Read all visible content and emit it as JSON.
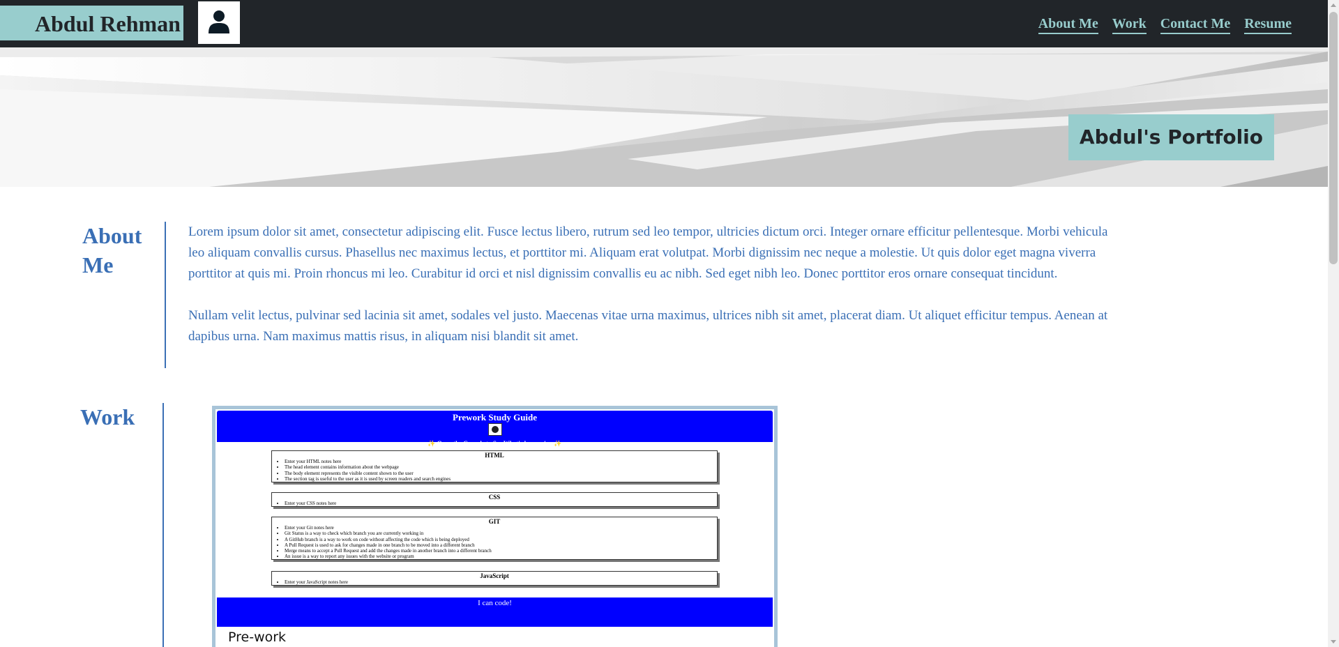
{
  "header": {
    "brand": "Abdul Rehman",
    "avatar_icon": "user-icon",
    "nav": [
      {
        "label": "About Me"
      },
      {
        "label": "Work"
      },
      {
        "label": "Contact Me"
      },
      {
        "label": "Resume"
      }
    ]
  },
  "hero": {
    "title": "Abdul's Portfolio"
  },
  "about": {
    "title_line1": "About",
    "title_line2": "Me",
    "paragraphs": [
      "Lorem ipsum dolor sit amet, consectetur adipiscing elit. Fusce lectus libero, rutrum sed leo tempor, ultricies dictum orci. Integer ornare efficitur pellentesque. Morbi vehicula leo aliquam convallis cursus. Phasellus nec maximus lectus, et porttitor mi. Aliquam erat volutpat. Morbi dignissim nec neque a molestie. Ut quis dolor eget magna viverra porttitor at quis mi. Proin rhoncus mi leo. Curabitur id orci et nisl dignissim convallis eu ac nibh. Sed eget nibh leo. Donec porttitor eros ornare consequat tincidunt.",
      "Nullam velit lectus, pulvinar sed lacinia sit amet, sodales vel justo. Maecenas vitae urna maximus, ultrices nibh sit amet, placerat diam. Ut aliquet efficitur tempus. Aenean at dapibus urna. Nam maximus mattis risus, in aliquam nisi blandit sit amet."
    ]
  },
  "work": {
    "title": "Work",
    "project": {
      "caption": "Pre-work",
      "screenshot": {
        "heading": "Prework Study Guide",
        "subheading": "✨ Open the Console to See What's happening ✨",
        "sections": [
          {
            "title": "HTML",
            "items": [
              "Enter your HTML notes here",
              "The head element contains information about the webpage",
              "The body element represents the visible content shown to the user",
              "The section tag is useful to the user as it is used by screen readers and search engines"
            ]
          },
          {
            "title": "CSS",
            "items": [
              "Enter your CSS notes here"
            ]
          },
          {
            "title": "GIT",
            "items": [
              "Enter your Git notes here",
              "Git Status is a way to check which branch you are currently working in",
              "A GitHub branch is a way to work on code without affecting the code which is being deployed",
              "A Pull Request is used to ask for changes made in one branch to be moved into a different branch",
              "Merge means to accept a Pull Request and add the changes made in another branch into a different branch",
              "An issue is a way to report any issues with the website or program"
            ]
          },
          {
            "title": "JavaScript",
            "items": [
              "Enter your JavaScript notes here"
            ]
          }
        ],
        "footer": "I can code!"
      }
    }
  },
  "colors": {
    "header_bg": "#212529",
    "accent": "#98cdcd",
    "text_blue": "#3a6fb5",
    "shot_blue": "#0000ff"
  }
}
